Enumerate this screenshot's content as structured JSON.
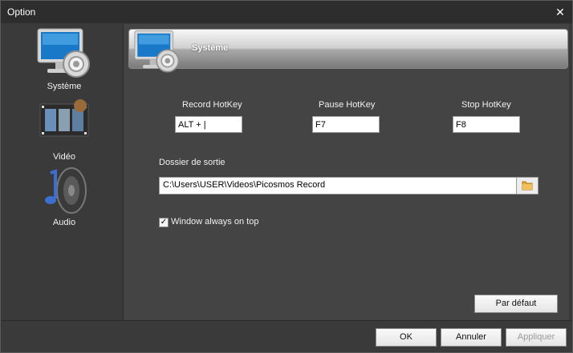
{
  "window": {
    "title": "Option",
    "close_icon": "close-icon"
  },
  "sidebar": {
    "items": [
      {
        "label": "Système",
        "icon": "monitor-gear-icon",
        "selected": true
      },
      {
        "label": "Vidéo",
        "icon": "film-strip-icon",
        "selected": false
      },
      {
        "label": "Audio",
        "icon": "speaker-note-icon",
        "selected": false
      }
    ]
  },
  "section": {
    "title": "Système",
    "icon": "monitor-gear-icon"
  },
  "hotkeys": {
    "record": {
      "label": "Record HotKey",
      "value": "ALT + |"
    },
    "pause": {
      "label": "Pause HotKey",
      "value": "F7"
    },
    "stop": {
      "label": "Stop HotKey",
      "value": "F8"
    }
  },
  "output": {
    "label": "Dossier de sortie",
    "path": "C:\\Users\\USER\\Videos\\Picosmos Record",
    "browse_icon": "folder-icon"
  },
  "options": {
    "always_on_top": {
      "label": "Window always on top",
      "checked": true
    }
  },
  "buttons": {
    "default": "Par défaut",
    "ok": "OK",
    "cancel": "Annuler",
    "apply": "Appliquer",
    "apply_enabled": false
  }
}
